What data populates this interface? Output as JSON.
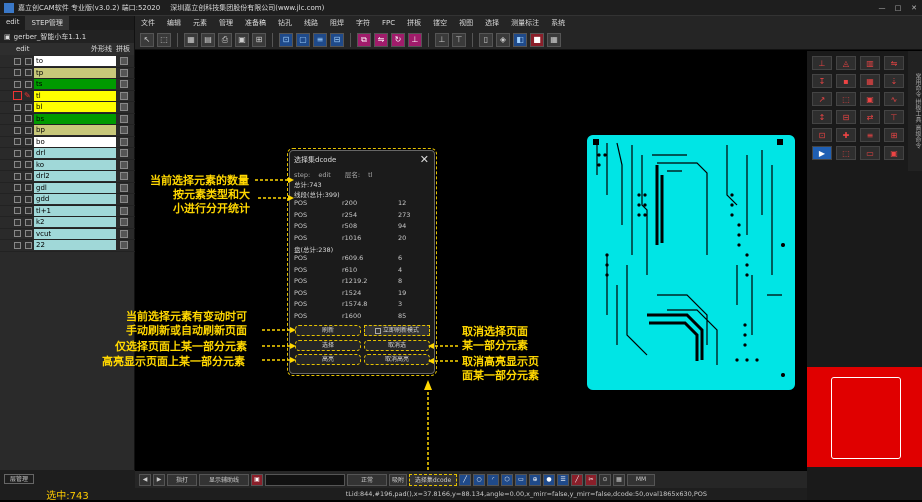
{
  "title_bar": {
    "app_title": "嘉立创CAM软件 专业版(v3.0.2) 端口:52020",
    "company": "深圳嘉立创科技集团股份有限公司(www.jlc.com)",
    "win_controls": [
      "—",
      "□",
      "✕"
    ]
  },
  "menu": [
    "文件",
    "编辑",
    "元素",
    "管理",
    "准备稿",
    "钻孔",
    "线路",
    "阻焊",
    "字符",
    "FPC",
    "拼板",
    "镂空",
    "视图",
    "选择",
    "测量标注",
    "系统"
  ],
  "left_panel": {
    "tabs": [
      "edit",
      "STEP管理"
    ],
    "job": "gerber_智能小车1.1.1",
    "header_step": "edit",
    "header_outline": "外形线",
    "header_panel": "拼板",
    "layers": [
      {
        "name": "to",
        "color": "#ffffff"
      },
      {
        "name": "tp",
        "color": "#c8c87a"
      },
      {
        "name": "ts",
        "color": "#009a00"
      },
      {
        "name": "tl",
        "color": "#ffff00",
        "active": true
      },
      {
        "name": "bl",
        "color": "#ffff00"
      },
      {
        "name": "bs",
        "color": "#009a00"
      },
      {
        "name": "bp",
        "color": "#c8c87a"
      },
      {
        "name": "bo",
        "color": "#ffffff"
      },
      {
        "name": "drl",
        "color": "#a0d8d8"
      },
      {
        "name": "ko",
        "color": "#a0d8d8"
      },
      {
        "name": "drl2",
        "color": "#a0d8d8"
      },
      {
        "name": "gdl",
        "color": "#a0d8d8"
      },
      {
        "name": "gdd",
        "color": "#a0d8d8"
      },
      {
        "name": "tl+1",
        "color": "#a0d8d8"
      },
      {
        "name": "k2",
        "color": "#a0d8d8"
      },
      {
        "name": "vcut",
        "color": "#a0d8d8"
      },
      {
        "name": "22",
        "color": "#a0d8d8"
      }
    ],
    "layer_manage": "层管理",
    "selected_count": "选中:743"
  },
  "dialog": {
    "title": "选择集dcode",
    "step_label": "step:",
    "step_value": "edit",
    "layer_label": "层名:",
    "layer_value": "tl",
    "total": "总计:743",
    "line_group": "线段(总计:399)",
    "line_rows": [
      {
        "type": "POS",
        "size": "r200",
        "count": "12"
      },
      {
        "type": "POS",
        "size": "r254",
        "count": "273"
      },
      {
        "type": "POS",
        "size": "r508",
        "count": "94"
      },
      {
        "type": "POS",
        "size": "r1016",
        "count": "20"
      }
    ],
    "pad_group": "盘(总计:238)",
    "pad_rows": [
      {
        "type": "POS",
        "size": "r609.6",
        "count": "6"
      },
      {
        "type": "POS",
        "size": "r610",
        "count": "4"
      },
      {
        "type": "POS",
        "size": "r1219.2",
        "count": "8"
      },
      {
        "type": "POS",
        "size": "r1524",
        "count": "19"
      },
      {
        "type": "POS",
        "size": "r1574.8",
        "count": "3"
      },
      {
        "type": "POS",
        "size": "r1600",
        "count": "85"
      }
    ],
    "refresh_btn": "刷新",
    "auto_refresh": "立即刷新模式",
    "select_btn": "选择",
    "unselect_btn": "取消选",
    "highlight_btn": "高亮",
    "unhighlight_btn": "取消高亮"
  },
  "annotations": {
    "a1": "当前选择元素的数量",
    "a2": "按元素类型和大",
    "a3": "小进行分开统计",
    "a4": "当前选择元素有变动时可",
    "a5": "手动刷新或自动刷新页面",
    "a6": "仅选择页面上某一部分元素",
    "a7": "高亮显示页面上某一部分元素",
    "a8": "取消选择页面",
    "a9": "某一部分元素",
    "a10": "取消高亮显示页",
    "a11": "面某一部分元素"
  },
  "bottom_bar": {
    "mode": "指打",
    "show_btn": "显示辅助线",
    "mode2": "正常",
    "snap": "吸附",
    "select_set": "选择集dcode",
    "unit": "MM"
  },
  "status_text": "tLid:844,#196,pad(),x=37.8166,y=88.134,angle=0.00,x_mirr=false,y_mirr=false,dcode:50,oval1865x630,POS",
  "right_panel": {
    "side_labels": [
      "常用命令",
      "拼板工具",
      "高级命令"
    ]
  }
}
